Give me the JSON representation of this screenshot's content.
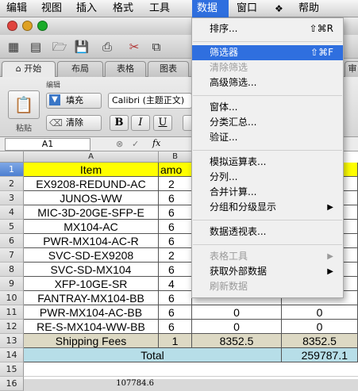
{
  "menubar": {
    "items": [
      "编辑",
      "视图",
      "插入",
      "格式",
      "工具",
      "数据",
      "窗口",
      "帮助"
    ],
    "script_icon": "script-icon"
  },
  "toolbar": {
    "icons": [
      "new-doc-icon",
      "template-icon",
      "open-folder-icon",
      "save-icon",
      "print-icon",
      "cut-icon",
      "copy-icon"
    ]
  },
  "ribbon": {
    "tabs": [
      "开始",
      "布局",
      "表格",
      "图表",
      "审"
    ],
    "group_label": "编辑",
    "paste_label": "粘贴",
    "fill_label": "填充",
    "clear_label": "清除",
    "font_name": "Calibri (主题正文)",
    "bold": "B",
    "italic": "I",
    "underline": "U"
  },
  "formula_bar": {
    "cell_ref": "A1",
    "fx": "fx"
  },
  "columns": [
    "A",
    "B"
  ],
  "rows": [
    "1",
    "2",
    "3",
    "4",
    "5",
    "6",
    "7",
    "8",
    "9",
    "10",
    "11",
    "12",
    "13",
    "14",
    "15",
    "16"
  ],
  "sheet": {
    "header": {
      "item": "Item",
      "amount": "amo"
    },
    "items": [
      {
        "name": "EX9208-REDUND-AC",
        "b": "2",
        "c": "",
        "d": ""
      },
      {
        "name": "JUNOS-WW",
        "b": "6",
        "c": "",
        "d": ""
      },
      {
        "name": "MIC-3D-20GE-SFP-E",
        "b": "6",
        "c": "",
        "d": ""
      },
      {
        "name": "MX104-AC",
        "b": "6",
        "c": "",
        "d": ""
      },
      {
        "name": "PWR-MX104-AC-R",
        "b": "6",
        "c": "",
        "d": ""
      },
      {
        "name": "SVC-SD-EX9208",
        "b": "2",
        "c": "",
        "d": ""
      },
      {
        "name": "SVC-SD-MX104",
        "b": "6",
        "c": "",
        "d": ""
      },
      {
        "name": "XFP-10GE-SR",
        "b": "4",
        "c": "",
        "d": ""
      },
      {
        "name": "FANTRAY-MX104-BB",
        "b": "6",
        "c": "",
        "d": ""
      },
      {
        "name": "PWR-MX104-AC-BB",
        "b": "6",
        "c": "0",
        "d": "0"
      },
      {
        "name": "RE-S-MX104-WW-BB",
        "b": "6",
        "c": "0",
        "d": "0"
      }
    ],
    "shipping": {
      "label": "Shipping Fees",
      "b": "1",
      "c": "8352.5",
      "d": "8352.5"
    },
    "total": {
      "label": "Total",
      "d": "259787.1"
    },
    "row16_value": "107784.6"
  },
  "data_menu": {
    "items": [
      {
        "label": "排序...",
        "shortcut": "⇧⌘R"
      },
      {
        "label": "筛选器",
        "shortcut": "⇧⌘F"
      },
      {
        "label": "清除筛选"
      },
      {
        "label": "高级筛选..."
      },
      {
        "label": "窗体..."
      },
      {
        "label": "分类汇总..."
      },
      {
        "label": "验证..."
      },
      {
        "label": "模拟运算表..."
      },
      {
        "label": "分列..."
      },
      {
        "label": "合并计算..."
      },
      {
        "label": "分组和分级显示"
      },
      {
        "label": "数据透视表..."
      },
      {
        "label": "表格工具"
      },
      {
        "label": "获取外部数据"
      },
      {
        "label": "刷新数据"
      }
    ]
  },
  "colors": {
    "menu_highlight": "#2f6fdf",
    "header_fill": "#ffff00",
    "shipping_fill": "#ddd9c4",
    "total_fill": "#b7dee8"
  }
}
